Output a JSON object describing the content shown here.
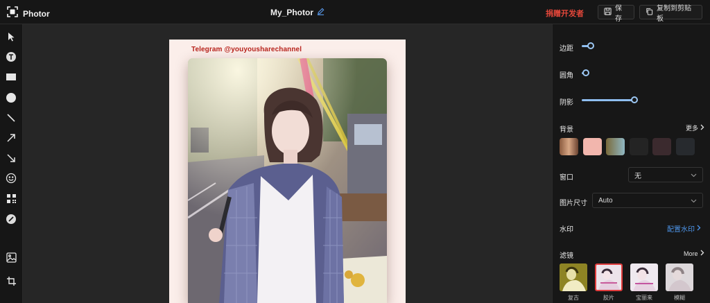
{
  "app": {
    "name": "Photor"
  },
  "header": {
    "doc_title": "My_Photor",
    "donate_label": "捐赠开发者",
    "save_label": "保存",
    "copy_label": "复制到剪贴板"
  },
  "toolbar": {
    "tools": [
      "pointer-icon",
      "text-icon",
      "rectangle-icon",
      "circle-icon",
      "line-icon",
      "arrow-icon",
      "arrow-down-right-icon",
      "emoji-icon",
      "qr-code-icon",
      "pen-icon",
      "image-icon",
      "crop-icon"
    ]
  },
  "canvas": {
    "caption": "Telegram @youyousharechannel",
    "frame_color": "#fbeeea"
  },
  "panel": {
    "padding": {
      "label": "边距",
      "value": 0.15
    },
    "radius": {
      "label": "圆角",
      "value": 0.05
    },
    "shadow": {
      "label": "阴影",
      "value": 0.9
    },
    "background": {
      "label": "背景",
      "more_label": "更多",
      "swatches": [
        "#d8a785",
        "#f2b6ad",
        "#8fb7c3",
        "#242424",
        "#3b2a2e",
        "#272a2e"
      ]
    },
    "window": {
      "label": "窗口",
      "value": "无"
    },
    "image_size": {
      "label": "图片尺寸",
      "value": "Auto"
    },
    "watermark": {
      "label": "水印",
      "link_label": "配置水印"
    },
    "filters": {
      "label": "滤镜",
      "more_label": "More",
      "items": [
        {
          "label": "复古",
          "selected": false
        },
        {
          "label": "胶片",
          "selected": true
        },
        {
          "label": "宝丽来",
          "selected": false
        },
        {
          "label": "模糊",
          "selected": false
        }
      ]
    },
    "accent_color": "#8fbef0",
    "link_color": "#4d95ea"
  }
}
